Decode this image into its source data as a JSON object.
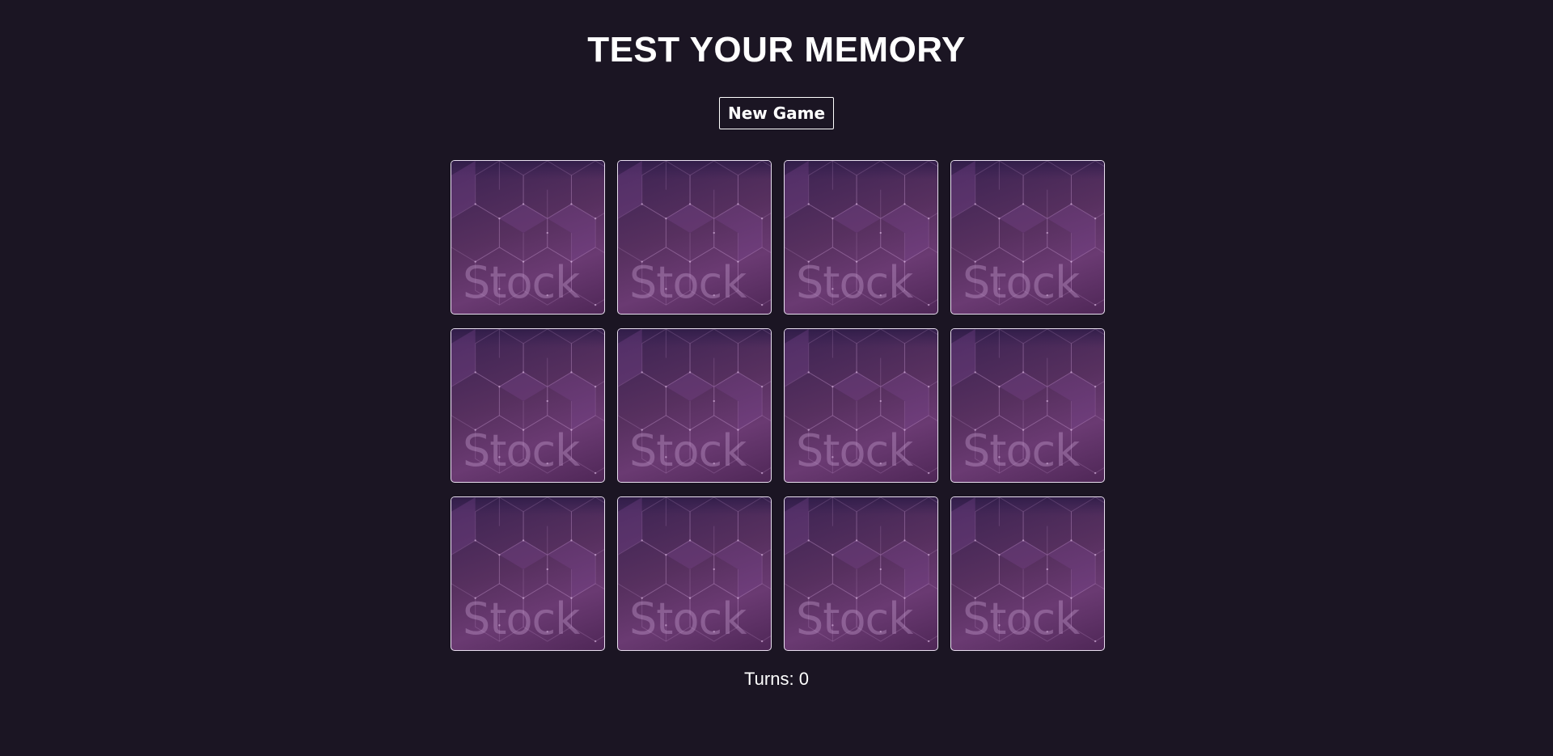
{
  "header": {
    "title": "TEST YOUR MEMORY"
  },
  "controls": {
    "new_game_label": "New Game"
  },
  "board": {
    "rows": 3,
    "columns": 4,
    "card_back_watermark": "Stock",
    "cards": [
      {
        "state": "face-down"
      },
      {
        "state": "face-down"
      },
      {
        "state": "face-down"
      },
      {
        "state": "face-down"
      },
      {
        "state": "face-down"
      },
      {
        "state": "face-down"
      },
      {
        "state": "face-down"
      },
      {
        "state": "face-down"
      },
      {
        "state": "face-down"
      },
      {
        "state": "face-down"
      },
      {
        "state": "face-down"
      },
      {
        "state": "face-down"
      }
    ]
  },
  "status": {
    "turns_text": "Turns: 0"
  },
  "colors": {
    "background": "#1b1523",
    "card_back": "#57305f",
    "text": "#ffffff"
  }
}
